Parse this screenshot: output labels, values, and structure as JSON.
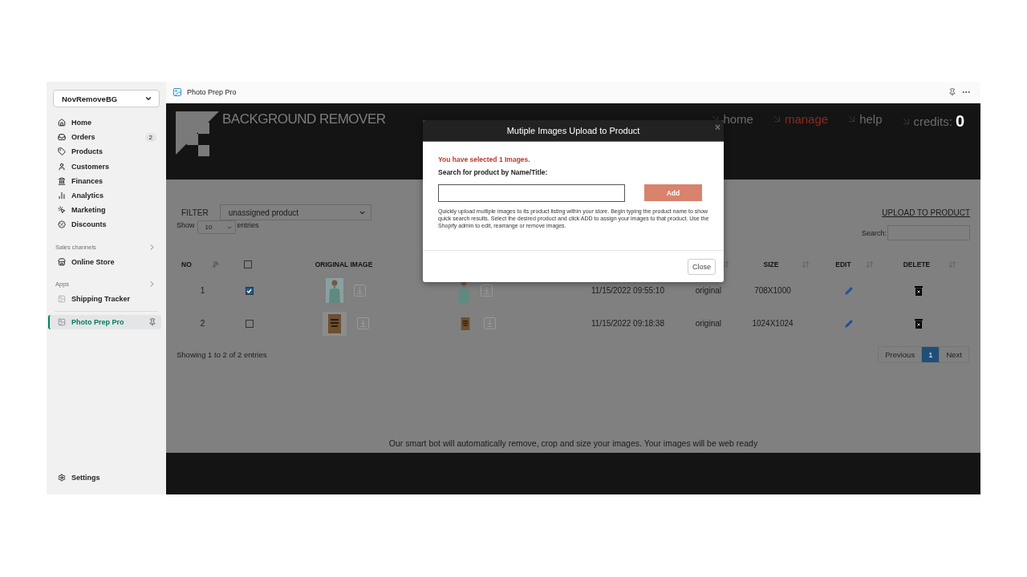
{
  "sidebar": {
    "store": "NovRemoveBG",
    "items": [
      {
        "label": "Home",
        "selected": false
      },
      {
        "label": "Orders",
        "badge": "2",
        "selected": false
      },
      {
        "label": "Products",
        "selected": false
      },
      {
        "label": "Customers",
        "selected": false
      },
      {
        "label": "Finances",
        "selected": false
      },
      {
        "label": "Analytics",
        "selected": false
      },
      {
        "label": "Marketing",
        "selected": false
      },
      {
        "label": "Discounts",
        "selected": false
      }
    ],
    "sections": [
      {
        "title": "Sales channels",
        "items": [
          {
            "label": "Online Store",
            "selected": false
          }
        ]
      },
      {
        "title": "Apps",
        "items": [
          {
            "label": "Shipping Tracker",
            "selected": false
          }
        ]
      }
    ],
    "pinned_app": {
      "label": "Photo Prep Pro",
      "selected": true
    },
    "settings": "Settings"
  },
  "app": {
    "title": "Photo Prep Pro",
    "brand": "BACKGROUND REMOVER",
    "nav": [
      {
        "label": "home",
        "selected": false
      },
      {
        "label": "manage",
        "selected": true
      },
      {
        "label": "help",
        "selected": false
      }
    ],
    "credits": {
      "label": "credits:",
      "value": "0"
    }
  },
  "filter": {
    "label": "FILTER",
    "value": "unassigned product"
  },
  "upload_link": "UPLOAD TO PRODUCT",
  "length": {
    "before": "Show",
    "value": "10",
    "after": "entries"
  },
  "search": {
    "label": "Search:"
  },
  "table": {
    "columns": [
      {
        "label": "NO",
        "kind": "text"
      },
      {
        "kind": "sort"
      },
      {
        "kind": "checkbox",
        "checked": false
      },
      {
        "label": "ORIGINAL IMAGE",
        "kind": "text"
      },
      {
        "kind": "hidden"
      },
      {
        "kind": "hidden"
      },
      {
        "kind": "hidden"
      },
      {
        "label": "SIZE",
        "kind": "text"
      },
      {
        "label": "EDIT",
        "kind": "text"
      },
      {
        "label": "DELETE",
        "kind": "text"
      }
    ],
    "rows": [
      {
        "no": "1",
        "checked": true,
        "kind": "person",
        "date": "11/15/2022 09:55:10",
        "type": "original",
        "size": "708X1000"
      },
      {
        "no": "2",
        "checked": false,
        "kind": "box",
        "date": "11/15/2022 09:18:38",
        "type": "original",
        "size": "1024X1024"
      }
    ]
  },
  "info": "Showing 1 to 2 of 2 entries",
  "pagination": [
    {
      "label": "Previous",
      "selected": false
    },
    {
      "label": "1",
      "selected": true
    },
    {
      "label": "Next",
      "selected": false
    }
  ],
  "footer_note": "Our smart bot will automatically remove, crop and size your images. Your images will be web ready",
  "modal": {
    "title": "Mutiple Images Upload to Product",
    "close_glyph": "×",
    "message": "You have selected 1 Images.",
    "field_label": "Search for product by Name/Title:",
    "add_button": "Add",
    "help": "Quickly upload multiple images to its product listing within your store. Begin typing the product name to show quick search results. Select the desired product and click ADD to assign your images to that product. Use the Shopify admin to edit, rearrange or remove images.",
    "close_button": "Close"
  }
}
